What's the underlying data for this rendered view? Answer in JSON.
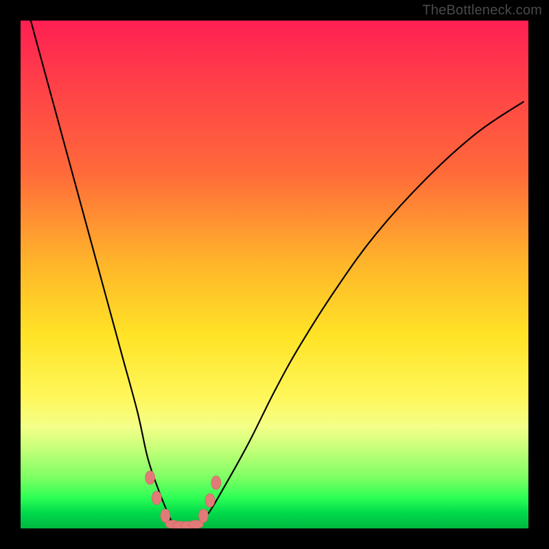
{
  "watermark": "TheBottleneck.com",
  "colors": {
    "frame": "#000000",
    "curve": "#000000",
    "marker_fill": "#e27a78",
    "marker_stroke": "#c96160",
    "gradient": [
      "#ff1f53",
      "#ff6a3a",
      "#ffe326",
      "#7dff64",
      "#00b840"
    ]
  },
  "chart_data": {
    "type": "line",
    "title": "",
    "xlabel": "",
    "ylabel": "",
    "xlim": [
      0,
      100
    ],
    "ylim": [
      0,
      100
    ],
    "grid": false,
    "legend": false,
    "note": "V-shaped bottleneck curve; y ≈ mismatch magnitude, bottom ≈ balanced. Values are approximate readings of pixel-level curve height as % of plot height.",
    "series": [
      {
        "name": "bottleneck-curve",
        "x": [
          2,
          5,
          8,
          11,
          14,
          17,
          20,
          23,
          25,
          27,
          29,
          30,
          31,
          33,
          35,
          37,
          40,
          45,
          50,
          55,
          62,
          70,
          80,
          90,
          99
        ],
        "y": [
          100,
          89,
          78,
          67,
          56,
          45,
          34,
          23,
          14,
          8,
          3,
          1,
          0.5,
          0.5,
          1,
          3,
          8,
          17,
          27,
          36,
          47,
          58,
          69,
          78,
          84
        ]
      }
    ],
    "markers": {
      "note": "Salmon capsule-like markers clustered near the valley floor.",
      "points_xy": [
        [
          25.5,
          10
        ],
        [
          26.8,
          6
        ],
        [
          28.5,
          2.5
        ],
        [
          30,
          0.8
        ],
        [
          31.5,
          0.6
        ],
        [
          33,
          0.6
        ],
        [
          34.5,
          0.8
        ],
        [
          36,
          2.5
        ],
        [
          37.3,
          5.5
        ],
        [
          38.5,
          9
        ]
      ]
    }
  }
}
